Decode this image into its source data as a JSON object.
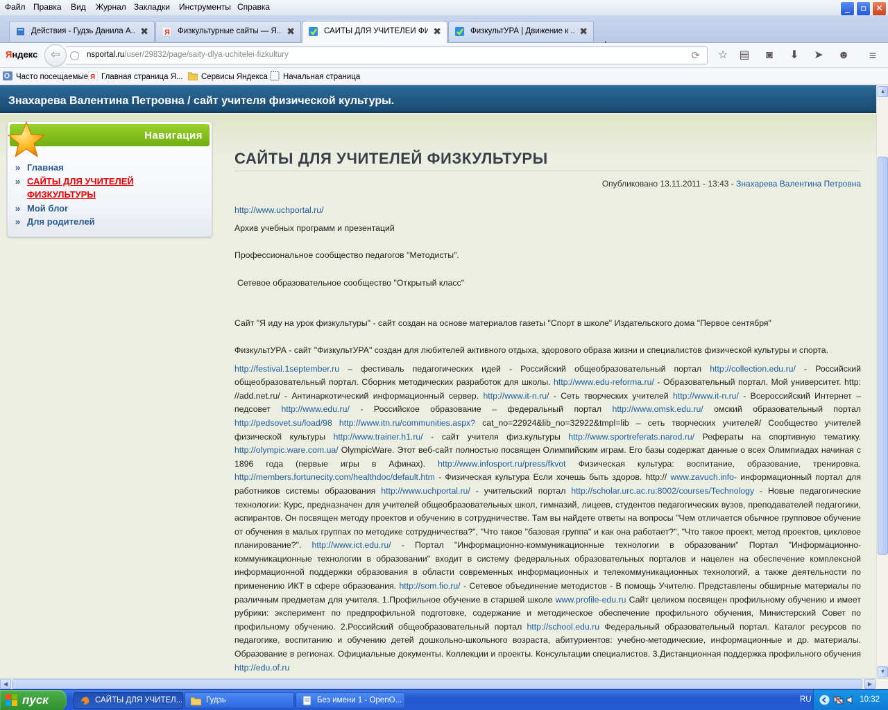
{
  "browser": {
    "menu": [
      "Файл",
      "Правка",
      "Вид",
      "Журнал",
      "Закладки",
      "Инструменты",
      "Справка"
    ],
    "window_controls": {
      "minimize": "_",
      "maximize": "▫",
      "close": "✕"
    },
    "tabs": [
      {
        "title": "Действия - Гудзь Данила А...",
        "icon": "book-icon"
      },
      {
        "title": "Физкультурные сайты — Я...",
        "icon": "yandex-icon"
      },
      {
        "title": "САЙТЫ ДЛЯ УЧИТЕЛЕЙ ФИЗ...",
        "icon": "check-icon",
        "active": true
      },
      {
        "title": "ФизкультУРА | Движение к ...",
        "icon": "check-icon"
      }
    ],
    "new_tab": "+",
    "yandex_logo": "Яндекс",
    "url_host": "nsportal.ru",
    "url_path": "/user/29832/page/saity-dlya-uchitelei-fizkultury",
    "bookmarks": [
      "Часто посещаемые",
      "Главная страница Я...",
      "Сервисы Яндекса",
      "Начальная страница"
    ]
  },
  "page": {
    "site_title": "Знахарева Валентина Петровна / сайт учителя физической культуры.",
    "nav": {
      "title": "Навигация",
      "bullet": "»",
      "items": [
        "Главная",
        "САЙТЫ ДЛЯ УЧИТЕЛЕЙ ФИЗКУЛЬТУРЫ",
        "Мой блог",
        "Для родителей"
      ],
      "active_index": 1
    },
    "heading": "САЙТЫ ДЛЯ УЧИТЕЛЕЙ ФИЗКУЛЬТУРЫ",
    "meta": {
      "published": "Опубликовано 13.11.2011 - 13:43 - ",
      "author": "Знахарева Валентина Петровна"
    },
    "p1_link": "http://www.uchportal.ru/",
    "p2": "Архив учебных программ и презентаций",
    "p3": "Профессиональное сообщество педагогов \"Методисты\".",
    "p4": "Сетевое образовательное сообщество \"Открытый класс\"",
    "p5": "Сайт \"Я иду на урок физкультуры\" - сайт создан на основе материалов газеты \"Спорт в школе\" Издательского дома \"Первое сентября\"",
    "p6": "ФизкультУРА - сайт \"ФизкультУРА\" создан для любителей активного отдыха, здорового образа жизни и специалистов физической культуры и спорта.",
    "long": [
      {
        "t": "http://festival.1september.ru",
        "l": true
      },
      {
        "t": " – фестиваль педагогических идей - Российский общеобразовательный портал "
      },
      {
        "t": "http://collection.edu.ru/",
        "l": true
      },
      {
        "t": " - Российский общеобразовательный портал. Сборник методических разработок для школы. "
      },
      {
        "t": "http://www.edu-reforma.ru/",
        "l": true
      },
      {
        "t": " - Образовательный портал. Мой университет. http: //add.net.ru/ - Антинаркотический информационный сервер. "
      },
      {
        "t": "http://www.it-n.ru/",
        "l": true
      },
      {
        "t": " - Сеть творческих учителей "
      },
      {
        "t": "http://www.it-n.ru/",
        "l": true
      },
      {
        "t": " - Всероссийский Интернет – педсовет "
      },
      {
        "t": "http://www.edu.ru/",
        "l": true
      },
      {
        "t": " - Российское образование – федеральный портал "
      },
      {
        "t": "http://www.omsk.edu.ru/",
        "l": true
      },
      {
        "t": " омский образовательный портал "
      },
      {
        "t": "http://pedsovet.su/load/98",
        "l": true
      },
      {
        "t": " "
      },
      {
        "t": "http://www.itn.ru/communities.aspx?",
        "l": true
      },
      {
        "t": " cat_no=22924&lib_no=32922&tmpl=lib – сеть творческих учителей/ Сообщество учителей физической культуры "
      },
      {
        "t": "http://www.trainer.h1.ru/",
        "l": true
      },
      {
        "t": " - сайт  учителя  физ.культуры "
      },
      {
        "t": "http://www.sportreferats.narod.ru/",
        "l": true
      },
      {
        "t": "     Рефераты на спортивную тематику. "
      },
      {
        "t": "http://olympic.ware.com.ua/",
        "l": true
      },
      {
        "t": " OlympicWare. Этот веб-сайт полностью посвящен Олимпийским играм. Его базы содержат данные о всех Олимпиадах начиная с 1896 года (первые игры в Афинах). "
      },
      {
        "t": "http://www.infosport.ru/press/fkvot",
        "l": true
      },
      {
        "t": " Физическая культура: воспитание, образование, тренировка.  "
      },
      {
        "t": "http://members.fortunecity.com/healthdoc/default.htm",
        "l": true
      },
      {
        "t": " - Физическая культура Если хочешь быть здоров. http:// "
      },
      {
        "t": "www.zavuch.info",
        "l": true
      },
      {
        "t": "- информационный портал для работников системы образования "
      },
      {
        "t": "http://www.uchportal.ru/",
        "l": true
      },
      {
        "t": " - учительский портал "
      },
      {
        "t": "http://scholar.urc.ac.ru:8002/courses/Technology",
        "l": true
      },
      {
        "t": " - Новые педагогические технологии: Курс, предназначен для учителей общеобразовательных школ, гимназий, лицеев, студентов педагогических вузов, преподавателей педагогики, аспирантов. Он посвящен методу проектов и обучению в сотрудничестве. Там вы найдете ответы на вопросы \"Чем отличается обычное групповое обучение от обучения в малых группах по методике сотрудничества?\", \"Что такое \"базовая группа\" и как она работает?\", \"Что такое проект, метод проектов, цикловое планирование?\". "
      },
      {
        "t": "http://www.ict.edu.ru/",
        "l": true
      },
      {
        "t": " - Портал \"Информационно-коммуникационные технологии в образовании\" Портал \"Информационно-коммуникационные технологии в образовании\" входит в систему федеральных образовательных порталов и нацелен на обеспечение комплексной информационной поддержки образования в области современных информационных и телекоммуникационных технологий, а также деятельности по применению ИКТ в сфере образования. "
      },
      {
        "t": "http://som.fio.ru/",
        "l": true
      },
      {
        "t": " - Сетевое объединение методистов - В помощь Учителю. Представлены обширные материалы по различным предметам для учителя. 1.Профильное обучение в старшей школе "
      },
      {
        "t": "www.profile-edu.ru",
        "l": true
      },
      {
        "t": " Сайт целиком посвящен профильному обучению и имеет рубрики: эксперимент по предпрофильной подготовке, содержание и методическое обеспечение профильного обучения, Министерский Совет по профильному обучению. 2.Российский общеобразовательный портал "
      },
      {
        "t": "http://school.edu.ru",
        "l": true
      },
      {
        "t": " Федеральный образовательный портал. Каталог ресурсов по педагогике, воспитанию и обучению детей дошкольно-школьного возраста, абитуриентов: учебно-методические, информационные и др. материалы. Образование в регионах. Официальные документы. Коллекции и проекты. Консультации специалистов. 3.Дистанционная поддержка профильного обучения "
      },
      {
        "t": "http://edu.of.ru",
        "l": true
      }
    ]
  },
  "taskbar": {
    "start": "пуск",
    "tasks": [
      {
        "label": "САЙТЫ ДЛЯ УЧИТЕЛ...",
        "icon": "firefox-icon",
        "active": true
      },
      {
        "label": "Гудзь",
        "icon": "folder-icon"
      },
      {
        "label": "Без имени 1 - OpenO...",
        "icon": "document-icon"
      }
    ],
    "language": "RU",
    "clock": "10:32"
  },
  "colors": {
    "header": "#1f5a86",
    "nav_head": "#80bf1c",
    "link": "#1b5d9e",
    "active_nav": "#ee0000",
    "page_bg": "#eceee1"
  }
}
